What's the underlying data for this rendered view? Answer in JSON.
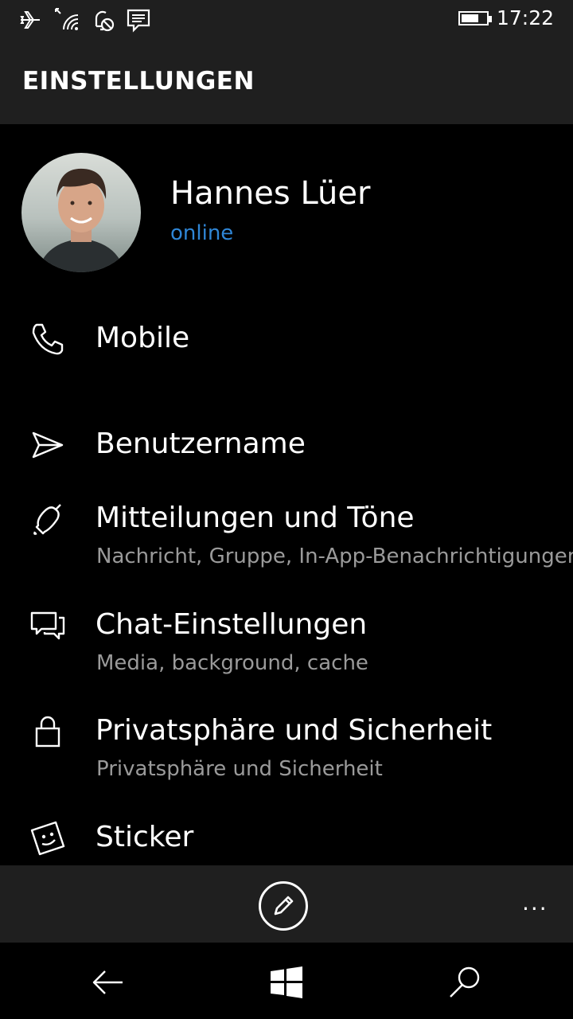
{
  "status_bar": {
    "time": "17:22",
    "battery_level": 0.7,
    "icons": [
      "airplane-icon",
      "wifi-icon",
      "quiet-hours-icon",
      "message-icon",
      "battery-icon"
    ]
  },
  "header": {
    "title": "EINSTELLUNGEN"
  },
  "profile": {
    "name": "Hannes Lüer",
    "status": "online",
    "status_color": "#2f86d6"
  },
  "settings": {
    "mobile": {
      "label": "Mobile",
      "icon": "phone-icon"
    },
    "username": {
      "label": "Benutzername",
      "icon": "send-icon"
    },
    "notifications": {
      "label": "Mitteilungen und Töne",
      "sub": "Nachricht, Gruppe, In-App-Benachrichtigungen",
      "icon": "bell-icon"
    },
    "chat": {
      "label": "Chat-Einstellungen",
      "sub": "Media, background, cache",
      "icon": "chat-icon"
    },
    "privacy": {
      "label": "Privatsphäre und Sicherheit",
      "sub": "Privatsphäre und Sicherheit",
      "icon": "lock-icon"
    },
    "sticker": {
      "label": "Sticker",
      "icon": "sticker-icon"
    }
  },
  "app_bar": {
    "edit_icon": "pencil-icon",
    "more": "..."
  },
  "nav_bar": {
    "icons": [
      "back-icon",
      "windows-icon",
      "search-icon"
    ]
  }
}
